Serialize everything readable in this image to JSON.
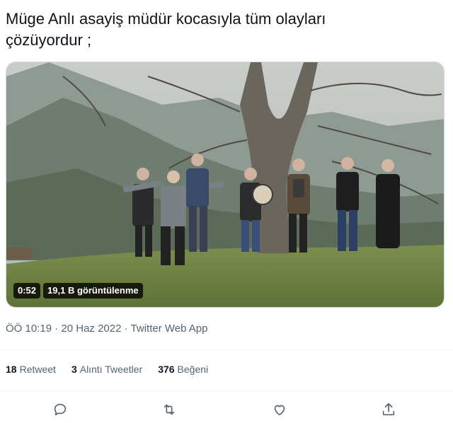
{
  "tweet": {
    "text_line1": "Müge Anlı asayiş müdür kocasıyla tüm olayları",
    "text_line2": "çözüyordur ;"
  },
  "video": {
    "duration": "0:52",
    "views": "19,1 B görüntülenme"
  },
  "meta": {
    "time": "ÖÖ 10:19",
    "separator1": " · ",
    "date": "20 Haz 2022",
    "separator2": " · ",
    "source": "Twitter Web App"
  },
  "stats": {
    "retweets_count": "18",
    "retweets_label": "Retweet",
    "quotes_count": "3",
    "quotes_label": "Alıntı Tweetler",
    "likes_count": "376",
    "likes_label": "Beğeni"
  },
  "actions": [
    "reply-icon",
    "retweet-icon",
    "like-icon",
    "share-icon"
  ],
  "colors": {
    "text": "#0f1419",
    "secondary": "#536471",
    "divider": "#eff3f4",
    "icon": "#536471"
  }
}
